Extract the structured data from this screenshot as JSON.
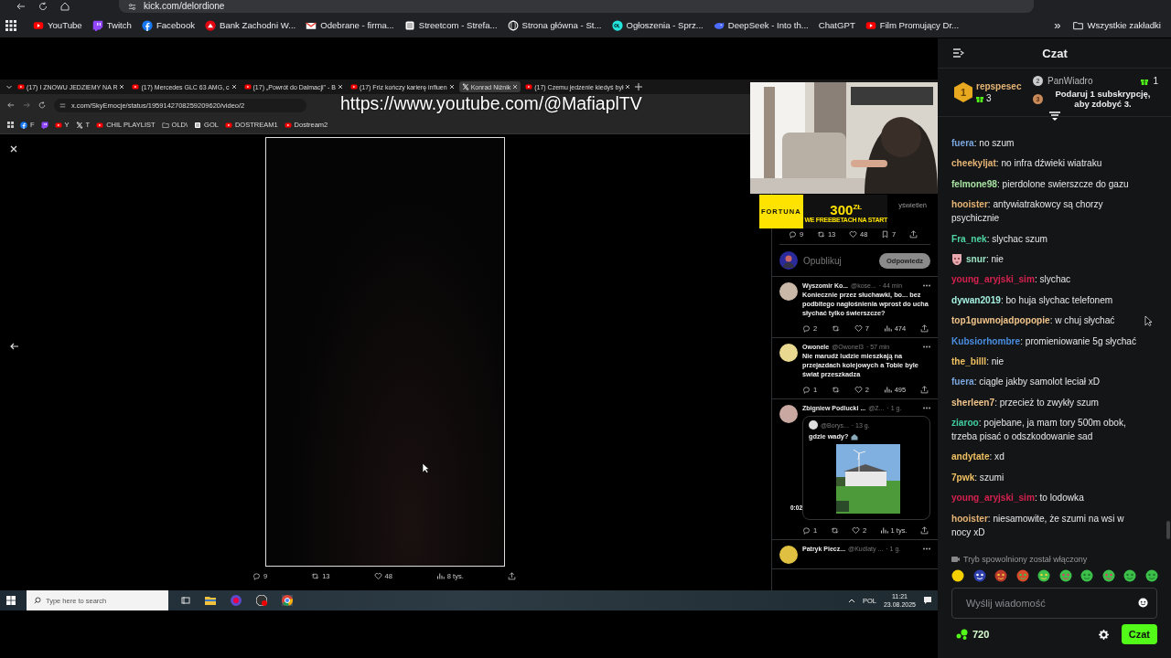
{
  "browser": {
    "url": "kick.com/delordione",
    "bookmarks": [
      {
        "label": "YouTube",
        "kind": "yt"
      },
      {
        "label": "Twitch",
        "kind": "twitch"
      },
      {
        "label": "Facebook",
        "kind": "fb"
      },
      {
        "label": "Bank Zachodni W...",
        "kind": "bank"
      },
      {
        "label": "Odebrane - firma...",
        "kind": "mail"
      },
      {
        "label": "Streetcom - Strefa...",
        "kind": "page"
      },
      {
        "label": "Strona główna - St...",
        "kind": "globe"
      },
      {
        "label": "Ogłoszenia - Sprz...",
        "kind": "olx"
      },
      {
        "label": "DeepSeek - Into th...",
        "kind": "whale"
      },
      {
        "label": "ChatGPT",
        "kind": "none"
      },
      {
        "label": "Film Promujący Dr...",
        "kind": "yt"
      }
    ],
    "more": "»",
    "all_bookmarks": "Wszystkie zakładki"
  },
  "stream": {
    "overlay_url": "https://www.youtube.com/@MafiaplTV",
    "ad": {
      "brand": "FORTUNA",
      "amount": "300$^{ZŁ}$",
      "tagline": "WE FREEBETACH NA START"
    },
    "screen": {
      "tabs": [
        {
          "title": "(17) I ZNOWU JEDZIEMY NA R",
          "kind": "yt",
          "selected": false
        },
        {
          "title": "(17) Mercedes GLC 63 AMG, c",
          "kind": "yt",
          "selected": false
        },
        {
          "title": "(17) „Powrót do Dalmacji\" - B",
          "kind": "yt",
          "selected": false
        },
        {
          "title": "(17) Friz kończy karierę influen",
          "kind": "yt",
          "selected": false
        },
        {
          "title": "Konrad Niżnik",
          "kind": "x",
          "selected": true
        },
        {
          "title": "(17) Czemu jedzenie kiedyś był",
          "kind": "yt",
          "selected": false
        }
      ],
      "url": "x.com/SkyEmocje/status/1959142708259209620/video/2",
      "bookmarks": [
        {
          "label": "F",
          "kind": "fb"
        },
        {
          "kind": "twitch"
        },
        {
          "label": "Y",
          "kind": "yt"
        },
        {
          "label": "T",
          "kind": "x"
        },
        {
          "label": "CHIL PLAYLIST",
          "kind": "yt"
        },
        {
          "label": "OLD\\",
          "kind": "folder"
        },
        {
          "label": "GOL",
          "kind": "page"
        },
        {
          "label": "DOSTREAM1",
          "kind": "yt"
        },
        {
          "label": "Dostream2",
          "kind": "yt"
        }
      ],
      "video_stats": {
        "replies": "9",
        "reposts": "13",
        "likes": "48",
        "views": "8 tys."
      },
      "views_fragment": "yświetleń",
      "post_stats": {
        "replies": "9",
        "reposts": "13",
        "likes": "48",
        "bookmarks": "7"
      },
      "composer": {
        "placeholder": "Opublikuj",
        "button": "Odpowiedz"
      },
      "replies": [
        {
          "name": "Wyszomir Ko...",
          "handle": "@kose...",
          "time": "· 44 min",
          "text": "Koniecznie przez słuchawki, bo... bez podbitego nagłośnienia wprost do ucha słychać tylko świerszcze?",
          "stats": {
            "replies": "2",
            "likes": "7",
            "views": "474"
          }
        },
        {
          "name": "Owonele",
          "handle": "@Owonel3",
          "time": "· 57 min",
          "text": "Nie marudź ludzie mieszkają na przejazdach kolejowych a Tobie byle świat przeszkadza",
          "stats": {
            "replies": "1",
            "likes": "2",
            "views": "495"
          }
        },
        {
          "name": "Zbigniew Podlucki ...",
          "handle": "@Z...",
          "time": "· 1 g.",
          "quote": {
            "handle": "@Borys...",
            "time": "· 13 g.",
            "text": "gdzie wady?",
            "duration": "0:02"
          },
          "stats": {
            "replies": "1",
            "likes": "2",
            "views": "1 tys."
          }
        },
        {
          "name": "Patryk Piecz...",
          "handle": "@Kudlaty ...",
          "time": "· 1 g."
        }
      ],
      "taskbar": {
        "search_placeholder": "Type here to search",
        "lang": "POL",
        "time": "11:21",
        "date": "23.08.2025"
      }
    }
  },
  "chat": {
    "title": "Czat",
    "leaders": [
      {
        "rank": "1",
        "name": "repspesec",
        "gifts": "3"
      },
      {
        "rank": "2",
        "name": "PanWiadro",
        "gifts": "1"
      }
    ],
    "gift_prompt": {
      "rank": "3",
      "text": "Podaruj 1 subskrypcję, aby zdobyć 3."
    },
    "messages": [
      {
        "user": "fuera",
        "text": ": no szum",
        "color": "#7aa7e0",
        "badge": false
      },
      {
        "user": "cheekyljat",
        "text": ": no infra dźwieki wiatraku",
        "color": "#e6b574",
        "badge": false
      },
      {
        "user": "felmone98",
        "text": ": pierdolone swierszcze do gazu",
        "color": "#a6e3a1",
        "badge": false
      },
      {
        "user": "hooister",
        "text": ": antywiatrakowcy są chorzy psychicznie",
        "color": "#e6b574",
        "badge": false
      },
      {
        "user": "Fra_nek",
        "text": ": slychac szum",
        "color": "#4fd6a4",
        "badge": false
      },
      {
        "user": "snur",
        "text": ": nie",
        "color": "#9be3c4",
        "badge": true
      },
      {
        "user": "young_aryjski_sim",
        "text": ": slychac",
        "color": "#d4214f",
        "badge": false
      },
      {
        "user": "dywan2019",
        "text": ": bo huja slychac telefonem",
        "color": "#a3efe0",
        "badge": false
      },
      {
        "user": "top1guwnojadpopopie",
        "text": ": w chuj słychać",
        "color": "#f0c48a",
        "badge": false
      },
      {
        "user": "Kubsiorhombre",
        "text": ": promieniowanie 5g słychać",
        "color": "#4a8ee0",
        "badge": false
      },
      {
        "user": "the_billl",
        "text": ": nie",
        "color": "#f0c060",
        "badge": false
      },
      {
        "user": "fuera",
        "text": ": ciągle jakby samolot leciał xD",
        "color": "#7aa7e0",
        "badge": false
      },
      {
        "user": "sherleen7",
        "text": ": przecież to zwykły szum",
        "color": "#f0c48a",
        "badge": false
      },
      {
        "user": "ziaroo",
        "text": ": pojebane, ja mam tory 500m obok, trzeba pisać o odszkodowanie sad",
        "color": "#40cfa0",
        "badge": false
      },
      {
        "user": "andytate",
        "text": ": xd",
        "color": "#f0c060",
        "badge": false
      },
      {
        "user": "7pwk",
        "text": ": szumi",
        "color": "#f0c060",
        "badge": false
      },
      {
        "user": "young_aryjski_sim",
        "text": ": to lodowka",
        "color": "#d4214f",
        "badge": false
      },
      {
        "user": "hooister",
        "text": ": niesamowite, że szumi na wsi w nocy xD",
        "color": "#e6b574",
        "badge": false
      }
    ],
    "notice": "Tryb spowolniony został włączony",
    "input": {
      "placeholder": "Wyślij wiadomość"
    },
    "points": "720",
    "send": "Czat"
  }
}
